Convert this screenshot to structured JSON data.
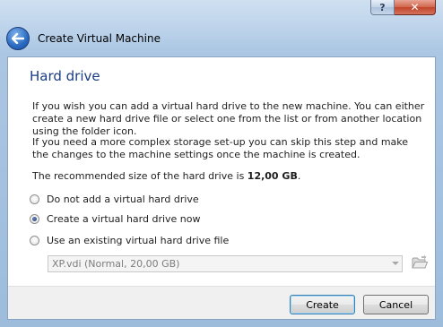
{
  "window": {
    "title": "Create Virtual Machine",
    "help_symbol": "?",
    "close_symbol": "✕"
  },
  "page": {
    "heading": "Hard drive",
    "para1": "If you wish you can add a virtual hard drive to the new machine. You can either create a new hard drive file or select one from the list or from another location using the folder icon.",
    "para2": "If you need a more complex storage set-up you can skip this step and make the changes to the machine settings once the machine is created.",
    "recommended_prefix": "The recommended size of the hard drive is ",
    "recommended_size": "12,00 GB",
    "recommended_suffix": "."
  },
  "options": [
    {
      "label": "Do not add a virtual hard drive",
      "checked": false
    },
    {
      "label": "Create a virtual hard drive now",
      "checked": true
    },
    {
      "label": "Use an existing virtual hard drive file",
      "checked": false
    }
  ],
  "existing_disk": {
    "selected": "XP.vdi (Normal, 20,00 GB)",
    "enabled": false
  },
  "buttons": {
    "create": "Create",
    "cancel": "Cancel"
  },
  "icons": {
    "back": "back-arrow-icon",
    "folder": "folder-open-icon"
  }
}
